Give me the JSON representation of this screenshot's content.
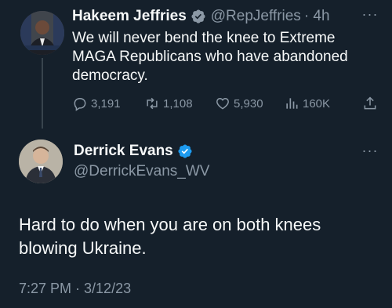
{
  "parent_tweet": {
    "author_name": "Hakeem Jeffries",
    "handle": "@RepJeffries",
    "separator_time": "· 4h",
    "text": "We will never bend the knee to Extreme MAGA Republicans who have abandoned democracy.",
    "stats": {
      "replies": "3,191",
      "retweets": "1,108",
      "likes": "5,930",
      "views": "160K"
    },
    "more_icon": "more-horizontal-icon"
  },
  "reply_tweet": {
    "author_name": "Derrick Evans",
    "handle": "@DerrickEvans_WV",
    "text": "Hard to do when you are on both knees blowing Ukraine.",
    "timestamp": "7:27 PM · 3/12/23",
    "more_icon": "more-horizontal-icon"
  },
  "colors": {
    "background": "#15202b",
    "text_primary": "#f7f9f9",
    "text_secondary": "#8b98a5",
    "verified_blue": "#1d9bf0",
    "thread_line": "#38444d"
  }
}
